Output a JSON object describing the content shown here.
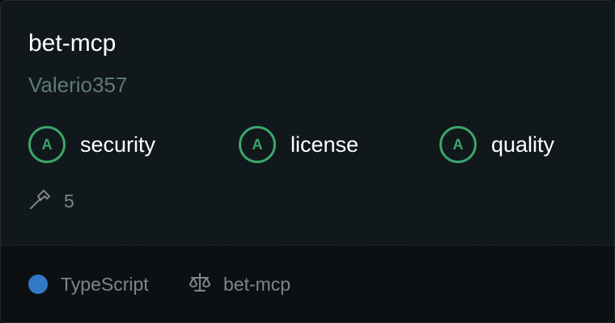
{
  "repo": {
    "name": "bet-mcp",
    "owner": "Valerio357"
  },
  "grades": [
    {
      "grade": "A",
      "label": "security"
    },
    {
      "grade": "A",
      "label": "license"
    },
    {
      "grade": "A",
      "label": "quality"
    }
  ],
  "tools": {
    "icon": "hammer-icon",
    "count": "5"
  },
  "footer": {
    "language": "TypeScript",
    "language_color": "#3178c6",
    "license_icon": "scale-icon",
    "license": "bet-mcp"
  },
  "colors": {
    "grade_accent": "#3aa56c",
    "owner_text": "#5f7a71"
  }
}
